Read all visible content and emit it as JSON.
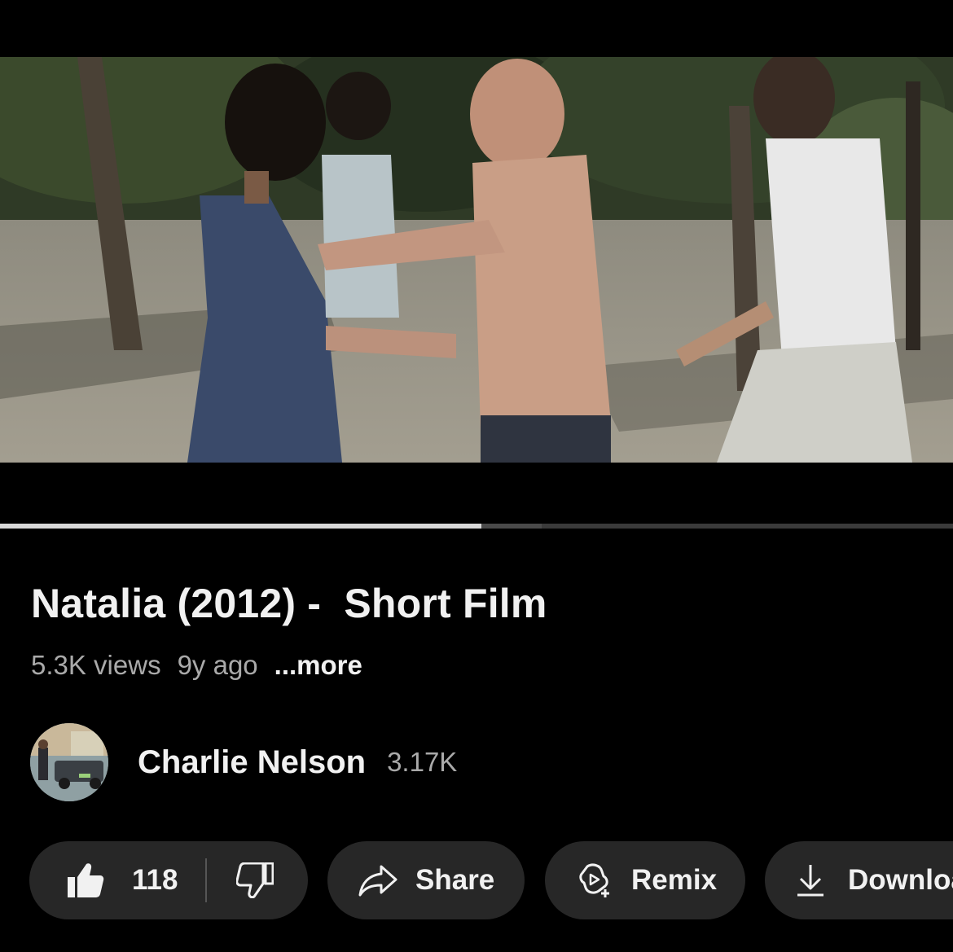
{
  "video": {
    "progress_fraction": 0.505
  },
  "title": "Natalia (2012) -  Short Film",
  "meta": {
    "views": "5.3K views",
    "age": "9y ago",
    "more": "...more"
  },
  "channel": {
    "name": "Charlie Nelson",
    "subscribers": "3.17K"
  },
  "actions": {
    "like_count": "118",
    "share_label": "Share",
    "remix_label": "Remix",
    "download_label": "Download"
  },
  "icons": {
    "like": "thumbs-up-icon",
    "dislike": "thumbs-down-icon",
    "share": "share-arrow-icon",
    "remix": "remix-icon",
    "download": "download-icon"
  },
  "colors": {
    "background": "#000000",
    "pill": "#272727",
    "text_primary": "#f1f1f1",
    "text_secondary": "#aaaaaa",
    "progress": "#d9d9d9"
  }
}
